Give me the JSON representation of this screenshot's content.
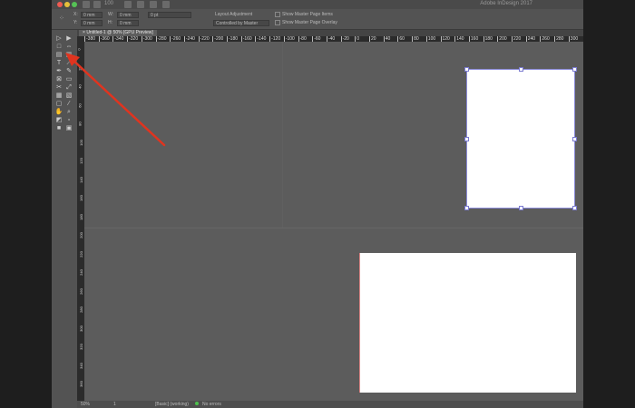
{
  "window": {
    "title": "Adobe InDesign 2017"
  },
  "titlebar": {
    "zoom_value": "100"
  },
  "control_bar": {
    "x_label": "X:",
    "y_label": "Y:",
    "w_label": "W:",
    "h_label": "H:",
    "x_value": "0 mm",
    "y_value": "0 mm",
    "w_value": "0 mm",
    "h_value": "0 mm",
    "stroke_value": "0 pt",
    "layout_label": "Layout Adjustment",
    "page_size_value": "Controlled by Master",
    "show_master_label": "Show Master Page Items",
    "show_overlay_label": "Show Master Page Overlay"
  },
  "document_tab": {
    "label": "Untitled-1 @ 50% [GPU Preview]",
    "close": "×"
  },
  "ruler_top_ticks": [
    "-380",
    "-360",
    "-340",
    "-320",
    "-300",
    "-280",
    "-260",
    "-240",
    "-220",
    "-200",
    "-180",
    "-160",
    "-140",
    "-120",
    "-100",
    "-80",
    "-60",
    "-40",
    "-20",
    "0",
    "20",
    "40",
    "60",
    "80",
    "100",
    "120",
    "140",
    "160",
    "180",
    "200",
    "220",
    "240",
    "260",
    "280",
    "300"
  ],
  "ruler_left_ticks": [
    "0",
    "20",
    "40",
    "60",
    "80",
    "100",
    "120",
    "140",
    "160",
    "180",
    "200",
    "220",
    "240",
    "260",
    "280",
    "300",
    "320",
    "340",
    "360"
  ],
  "status_bar": {
    "zoom": "50%",
    "page": "1",
    "master": "[Basic] (working)",
    "errors": "No errors"
  },
  "tools": [
    {
      "name": "selection-tool",
      "glyph": "▷"
    },
    {
      "name": "direct-selection-tool",
      "glyph": "▶"
    },
    {
      "name": "page-tool",
      "glyph": "□"
    },
    {
      "name": "gap-tool",
      "glyph": "⇔"
    },
    {
      "name": "content-collector-tool",
      "glyph": "▤"
    },
    {
      "name": "content-placer-tool",
      "glyph": "▥"
    },
    {
      "name": "type-tool",
      "glyph": "T"
    },
    {
      "name": "line-tool",
      "glyph": "⟋"
    },
    {
      "name": "pen-tool",
      "glyph": "✒"
    },
    {
      "name": "pencil-tool",
      "glyph": "✎"
    },
    {
      "name": "rectangle-frame-tool",
      "glyph": "⊠"
    },
    {
      "name": "rectangle-tool",
      "glyph": "▭"
    },
    {
      "name": "scissors-tool",
      "glyph": "✂"
    },
    {
      "name": "free-transform-tool",
      "glyph": "⤢"
    },
    {
      "name": "gradient-swatch-tool",
      "glyph": "▦"
    },
    {
      "name": "gradient-feather-tool",
      "glyph": "▧"
    },
    {
      "name": "note-tool",
      "glyph": "▢"
    },
    {
      "name": "eyedropper-tool",
      "glyph": "⁄"
    },
    {
      "name": "hand-tool",
      "glyph": "✋"
    },
    {
      "name": "zoom-tool",
      "glyph": "⌕"
    },
    {
      "name": "fill-stroke-swatch",
      "glyph": "◩"
    },
    {
      "name": "formatting-affects-container",
      "glyph": "▫"
    },
    {
      "name": "apply-color",
      "glyph": "■"
    },
    {
      "name": "screen-mode",
      "glyph": "▣"
    }
  ]
}
